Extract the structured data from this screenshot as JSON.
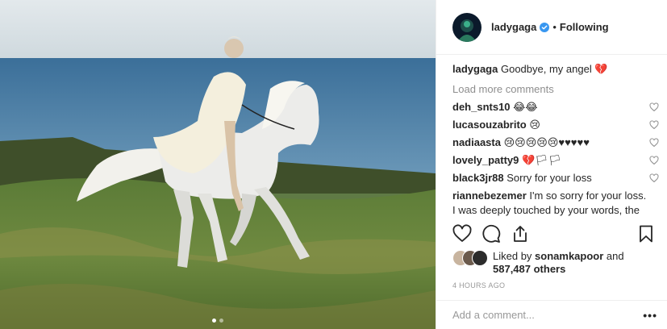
{
  "post": {
    "username": "ladygaga",
    "follow_status": "Following",
    "separator": "•",
    "caption_user": "ladygaga",
    "caption_text": "Goodbye, my angel 💔",
    "load_more": "Load more comments",
    "comments": [
      {
        "user": "deh_snts10",
        "text": "😂😂"
      },
      {
        "user": "lucasouzabrito",
        "text": "😢"
      },
      {
        "user": "nadiaasta",
        "text": "😢😢😢😢😢♥♥♥♥♥"
      },
      {
        "user": "lovely_patty9",
        "text": "💔🏳🏳"
      },
      {
        "user": "black3jr88",
        "text": "Sorry for your loss"
      },
      {
        "user": "riannebezemer",
        "text": "I'm so sorry for your loss. I was deeply touched by your words, the pictures and about the"
      }
    ],
    "likes": {
      "prefix": "Liked by",
      "liker": "sonamkapoor",
      "middle": "and",
      "count_text": "587,487 others"
    },
    "timestamp": "4 HOURS AGO",
    "add_comment_placeholder": "Add a comment...",
    "more_label": "•••",
    "carousel": {
      "total": 2,
      "active": 1
    }
  },
  "colors": {
    "verified": "#3897f0",
    "border": "#efefef",
    "muted": "#8e8e8e",
    "text": "#262626"
  },
  "icons": [
    "verified-badge-icon",
    "heart-icon",
    "comment-icon",
    "share-icon",
    "bookmark-icon",
    "comment-like-heart-icon",
    "more-options-icon"
  ]
}
